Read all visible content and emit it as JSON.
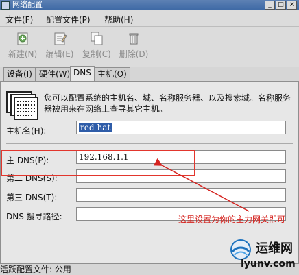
{
  "window": {
    "title": "网络配置",
    "controls": [
      "_",
      "□",
      "×"
    ]
  },
  "menu": {
    "items": [
      "文件(F)",
      "配置文件(P)",
      "帮助(H)"
    ]
  },
  "toolbar": {
    "buttons": [
      "新建(N)",
      "编辑(E)",
      "复制(C)",
      "删除(D)"
    ]
  },
  "tabs": [
    "设备(I)",
    "硬件(W)",
    "DNS",
    "主机(O)"
  ],
  "panel": {
    "intro": "您可以配置系统的主机名、域、名称服务器、以及搜索域。名称服务器被用来在网络上查寻其它主机。",
    "hostname_label": "主机名(H):",
    "hostname_value": "red-hat",
    "primary_dns_label": "主 DNS(P):",
    "primary_dns_value": "192.168.1.1",
    "secondary_dns_label": "第二 DNS(S):",
    "tertiary_dns_label": "第三 DNS(T):",
    "search_path_label": "DNS 搜寻路径:"
  },
  "annotation": {
    "note": "这里设置为你的主力网关即可",
    "color": "#d5231f"
  },
  "status": {
    "text": "活跃配置文件: 公用"
  },
  "watermark": {
    "brand": "运维网",
    "site": "iyunv.com"
  }
}
